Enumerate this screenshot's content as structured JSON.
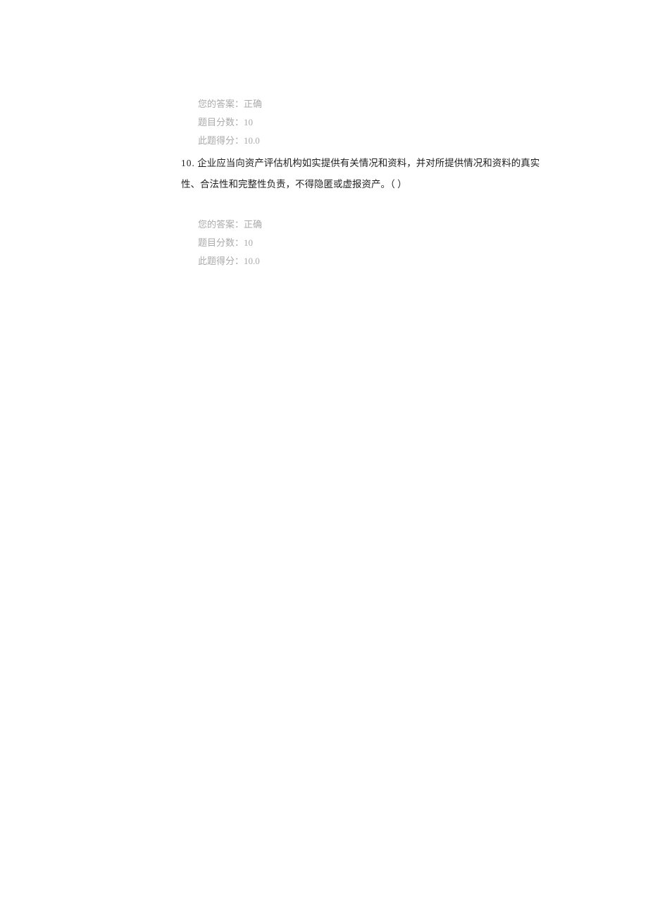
{
  "block1": {
    "answer_label": "您的答案：",
    "answer_value": "正确",
    "score_label": "题目分数：",
    "score_value": "10",
    "earned_label": "此题得分：",
    "earned_value": "10.0"
  },
  "question10": {
    "number": "10.",
    "text_line1": "企业应当向资产评估机构如实提供有关情况和资料，并对所提供情况和资料的真实",
    "text_line2": "性、合法性和完整性负责，不得隐匿或虚报资产。（ ）"
  },
  "block2": {
    "answer_label": "您的答案：",
    "answer_value": "正确",
    "score_label": "题目分数：",
    "score_value": "10",
    "earned_label": "此题得分：",
    "earned_value": "10.0"
  }
}
